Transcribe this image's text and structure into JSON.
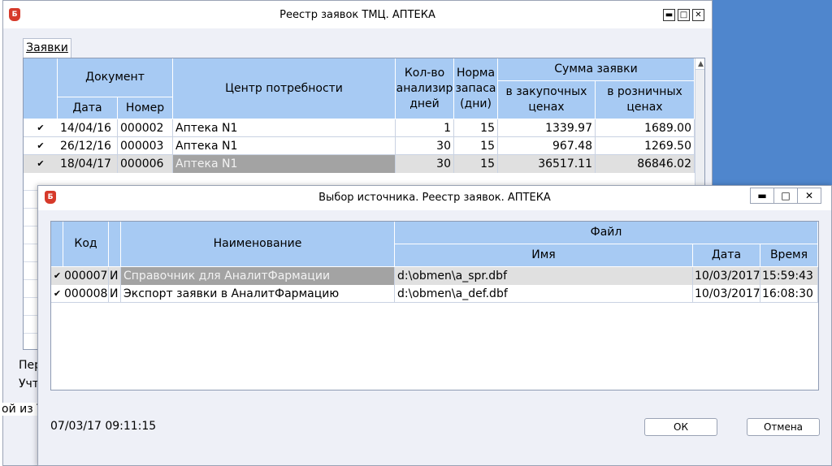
{
  "main_window": {
    "title": "Реестр заявок ТМЦ. АПТЕКА",
    "icon_letter": "Б",
    "controls": {
      "minimize": "▬",
      "maximize": "□",
      "close": "✕"
    },
    "tab": "Заявки",
    "grid": {
      "headers": {
        "document": "Документ",
        "date": "Дата",
        "number": "Номер",
        "center": "Центр потребности",
        "days": "Кол-во анализир дней",
        "norm": "Норма запаса (дни)",
        "sum": "Сумма заявки",
        "purchase": "в закупочных ценах",
        "retail": "в розничных ценах"
      },
      "rows": [
        {
          "check": "✔",
          "date": "14/04/16",
          "number": "000002",
          "center": "Аптека N1",
          "days": "1",
          "norm": "15",
          "purchase": "1339.97",
          "retail": "1689.00"
        },
        {
          "check": "✔",
          "date": "26/12/16",
          "number": "000003",
          "center": "Аптека N1",
          "days": "30",
          "norm": "15",
          "purchase": "967.48",
          "retail": "1269.50"
        },
        {
          "check": "✔",
          "date": "18/04/17",
          "number": "000006",
          "center": "Аптека N1",
          "days": "30",
          "norm": "15",
          "purchase": "36517.11",
          "retail": "86846.02"
        }
      ]
    },
    "under_texts": [
      "Пер",
      "Учт",
      "ой из Т"
    ]
  },
  "dialog": {
    "title": "Выбор источника. Реестр заявок.  АПТЕКА",
    "icon_letter": "Б",
    "controls": {
      "minimize": "▬",
      "maximize": "□",
      "close": "✕"
    },
    "grid": {
      "headers": {
        "code": "Код",
        "name": "Наименование",
        "file": "Файл",
        "file_name": "Имя",
        "date": "Дата",
        "time": "Время"
      },
      "rows": [
        {
          "check": "✔",
          "code": "000007",
          "type": "И",
          "name": "Справочник для АналитФармации",
          "file": "d:\\obmen\\a_spr.dbf",
          "date": "10/03/2017",
          "time": "15:59:43"
        },
        {
          "check": "✔",
          "code": "000008",
          "type": "И",
          "name": "Экспорт заявки в АналитФармацию",
          "file": "d:\\obmen\\a_def.dbf",
          "date": "10/03/2017",
          "time": "16:08:30"
        }
      ]
    },
    "status_datetime": "07/03/17 09:11:15",
    "ok_label": "ОК",
    "cancel_label": "Отмена"
  },
  "colors": {
    "header_blue": "#a7caf3",
    "selected_cell": "#a3a3a3",
    "desktop": "#4f86cd"
  }
}
